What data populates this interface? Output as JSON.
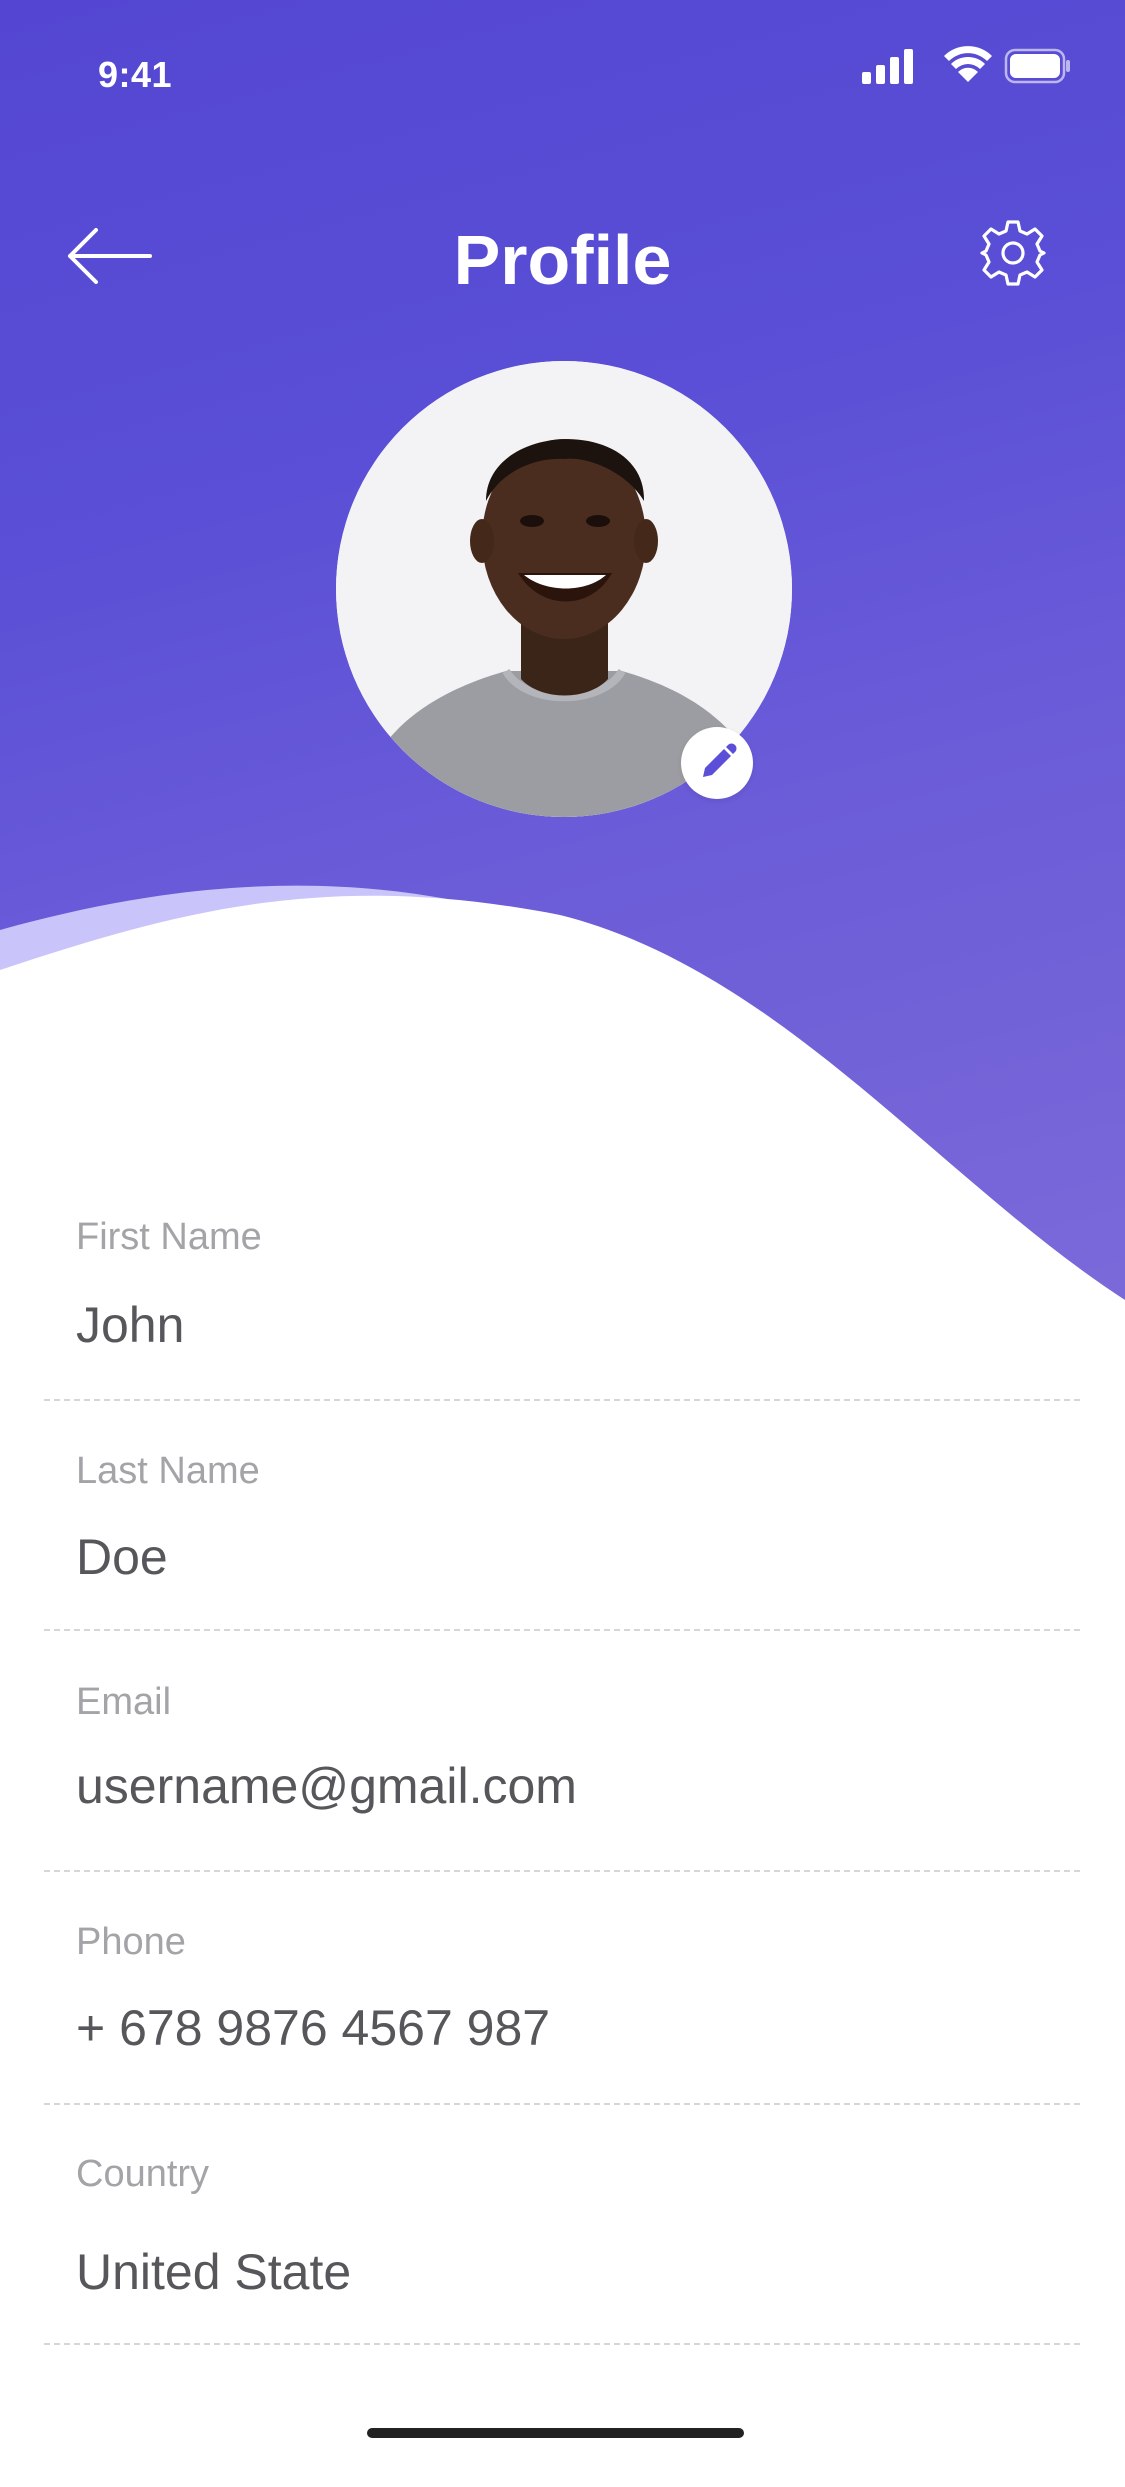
{
  "status_bar": {
    "time": "9:41"
  },
  "header": {
    "title": "Profile"
  },
  "fields": [
    {
      "label": "First Name",
      "value": "John"
    },
    {
      "label": "Last Name",
      "value": "Doe"
    },
    {
      "label": "Email",
      "value": "username@gmail.com"
    },
    {
      "label": "Phone",
      "value": "+ 678 9876 4567 987"
    },
    {
      "label": "Country",
      "value": "United State"
    }
  ],
  "icons": {
    "back": "arrow-left-icon",
    "settings": "gear-icon",
    "edit": "pencil-icon",
    "signal": "cellular-signal-icon",
    "wifi": "wifi-icon",
    "battery": "battery-icon"
  },
  "colors": {
    "primary": "#5a4fd6",
    "wave_light": "#c9c4fa",
    "label": "#a3a3a8",
    "value": "#56565b"
  }
}
